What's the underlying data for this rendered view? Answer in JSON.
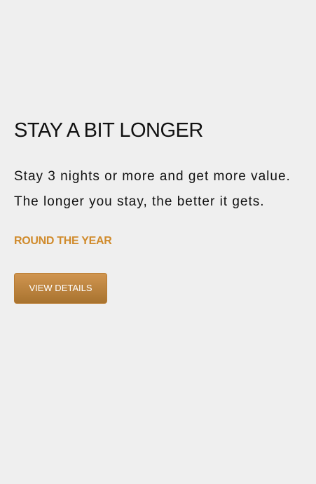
{
  "offer": {
    "title": "STAY A BIT LONGER",
    "description": "Stay 3 nights or more and get more value. The longer you stay, the better it gets.",
    "period": "ROUND THE YEAR",
    "button_label": "VIEW DETAILS"
  },
  "colors": {
    "accent": "#d08b2c",
    "background": "#efefef"
  }
}
